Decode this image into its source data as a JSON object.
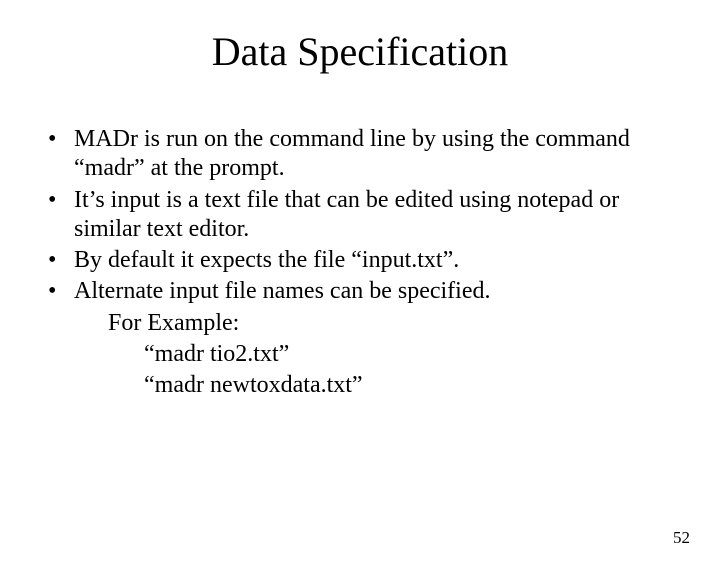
{
  "title": "Data Specification",
  "bullets": {
    "b1": "MADr is run on the command line by using the command “madr” at the prompt.",
    "b2": "It’s input is a text file that can be edited using notepad or similar text editor.",
    "b3": "By default it expects the file “input.txt”.",
    "b4": "Alternate input file names can be specified.",
    "b4_sub1": "For Example:",
    "b4_sub2": "“madr tio2.txt”",
    "b4_sub3": "“madr newtoxdata.txt”"
  },
  "page_number": "52"
}
